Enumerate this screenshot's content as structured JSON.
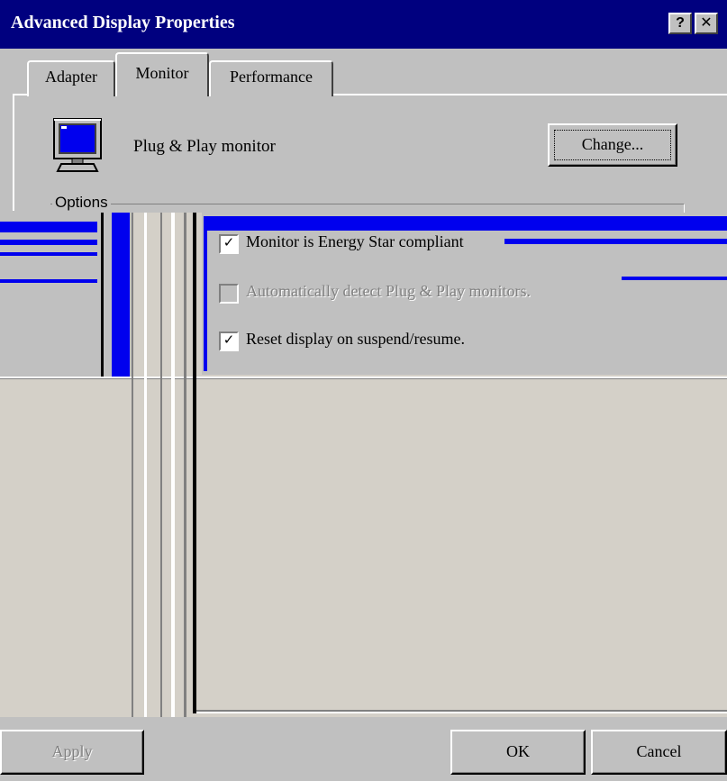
{
  "window": {
    "title": "Advanced Display Properties",
    "help_glyph": "?",
    "close_glyph": "✕"
  },
  "tabs": [
    {
      "label": "Adapter",
      "active": false
    },
    {
      "label": "Monitor",
      "active": true
    },
    {
      "label": "Performance",
      "active": false
    }
  ],
  "monitor": {
    "icon": "monitor-icon",
    "name": "Plug & Play monitor",
    "change_button": "Change..."
  },
  "options": {
    "legend": "Options",
    "items": [
      {
        "label": "Monitor is Energy Star compliant",
        "checked": true,
        "enabled": true
      },
      {
        "label": "Automatically detect Plug & Play monitors.",
        "checked": false,
        "enabled": false
      },
      {
        "label": "Reset display on suspend/resume.",
        "checked": true,
        "enabled": true
      }
    ]
  },
  "buttons": {
    "apply": "Apply",
    "ok": "OK",
    "cancel": "Cancel"
  },
  "colors": {
    "titlebar": "#00007f",
    "face": "#c0c0c0",
    "artifact_blue": "#0000ee",
    "lower_fill": "#d4d0c8"
  }
}
